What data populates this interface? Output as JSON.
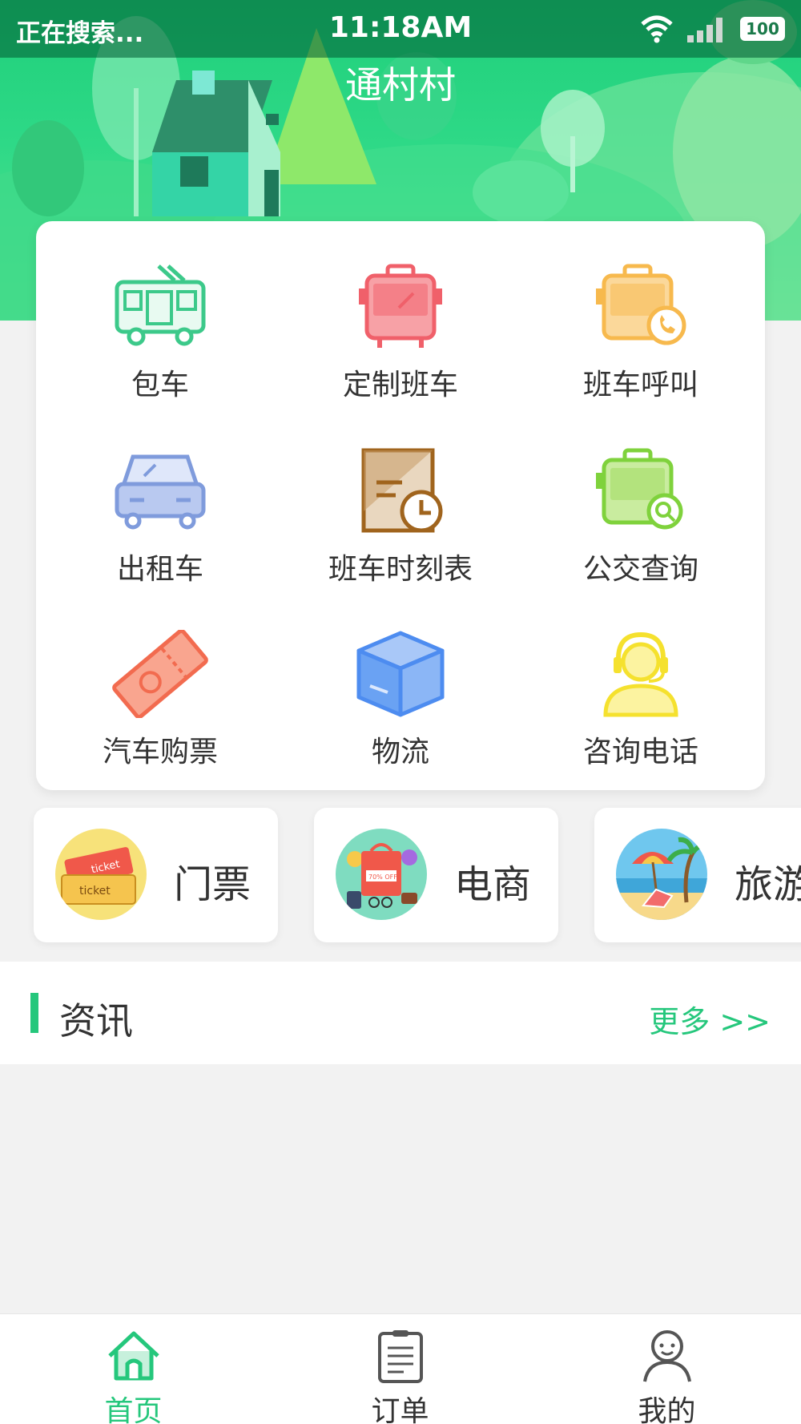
{
  "status_bar": {
    "left_text": "正在搜索...",
    "time": "11:18AM",
    "battery": "100"
  },
  "header": {
    "title": "通村村"
  },
  "services": [
    {
      "label": "包车",
      "icon": "bus-icon",
      "color": "#3cc98a"
    },
    {
      "label": "定制班车",
      "icon": "shuttle-bus-icon",
      "color": "#f0606a"
    },
    {
      "label": "班车呼叫",
      "icon": "bus-call-icon",
      "color": "#f7b94d"
    },
    {
      "label": "出租车",
      "icon": "taxi-icon",
      "color": "#7f9bdc"
    },
    {
      "label": "班车时刻表",
      "icon": "timetable-icon",
      "color": "#a0641d"
    },
    {
      "label": "公交查询",
      "icon": "bus-search-icon",
      "color": "#7fd23c"
    },
    {
      "label": "汽车购票",
      "icon": "ticket-icon",
      "color": "#f26b4f"
    },
    {
      "label": "物流",
      "icon": "package-icon",
      "color": "#4d8cf0"
    },
    {
      "label": "咨询电话",
      "icon": "customer-service-icon",
      "color": "#f5e12e"
    }
  ],
  "categories": [
    {
      "label": "门票",
      "icon": "tickets-thumbnail"
    },
    {
      "label": "电商",
      "icon": "shopping-thumbnail"
    },
    {
      "label": "旅游",
      "icon": "beach-thumbnail"
    }
  ],
  "news": {
    "title": "资讯",
    "more": "更多 >>"
  },
  "bottom_nav": [
    {
      "label": "首页",
      "icon": "home-icon",
      "active": true
    },
    {
      "label": "订单",
      "icon": "order-list-icon",
      "active": false
    },
    {
      "label": "我的",
      "icon": "profile-icon",
      "active": false
    }
  ],
  "colors": {
    "accent": "#25c77c",
    "text": "#333333",
    "background": "#f2f2f2"
  }
}
